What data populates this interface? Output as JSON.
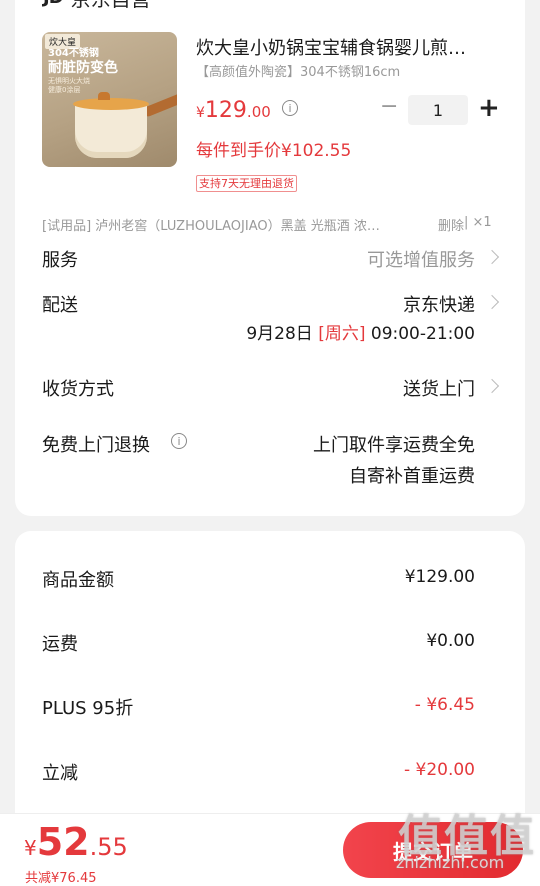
{
  "store": {
    "name": "京东自营",
    "logo": "JD"
  },
  "product": {
    "image": {
      "brand": "炊大皇",
      "line1": "304不锈钢",
      "line2": "耐脏防变色",
      "line3": "无惧明火大烧",
      "line4": "健康0涂层"
    },
    "title": "炊大皇小奶锅宝宝辅食锅婴儿煎…",
    "spec": "【高颜值外陶瓷】304不锈钢16cm",
    "price_currency": "¥",
    "price_int": "129",
    "price_dec": ".00",
    "info_icon": "info-icon",
    "quantity": "1",
    "minus": "−",
    "plus": "+",
    "final_price": "每件到手价¥102.55",
    "return_tag": "支持7天无理由退货"
  },
  "gift": {
    "text": "[试用品] 泸州老窖（LUZHOULAOJIAO）黑盖 光瓶酒 浓…",
    "delete": "删除",
    "count": "| ×1"
  },
  "rows": {
    "service": {
      "label": "服务",
      "value": "可选增值服务"
    },
    "delivery": {
      "label": "配送",
      "value": "京东快递",
      "date": "9月28日",
      "weekday": "[周六]",
      "time": "09:00-21:00"
    },
    "receive": {
      "label": "收货方式",
      "value": "送货上门"
    },
    "return": {
      "label": "免费上门退换",
      "line1": "上门取件享运费全免",
      "line2": "自寄补首重运费"
    }
  },
  "summary": {
    "items": [
      {
        "label": "商品金额",
        "value": "¥129.00",
        "negative": false
      },
      {
        "label": "运费",
        "value": "¥0.00",
        "negative": false
      },
      {
        "label": "PLUS 95折",
        "value": "- ¥6.45",
        "negative": true
      },
      {
        "label": "立减",
        "value": "- ¥20.00",
        "negative": true
      }
    ]
  },
  "bottom": {
    "currency": "¥",
    "total_int": "52",
    "total_dec": ".55",
    "discount": "共减¥76.45",
    "submit": "提交订单"
  },
  "watermark": {
    "big": "值值值",
    "small": "zhizhizhi.com"
  },
  "colors": {
    "accent": "#e4393c",
    "background": "#f2f2f2"
  }
}
